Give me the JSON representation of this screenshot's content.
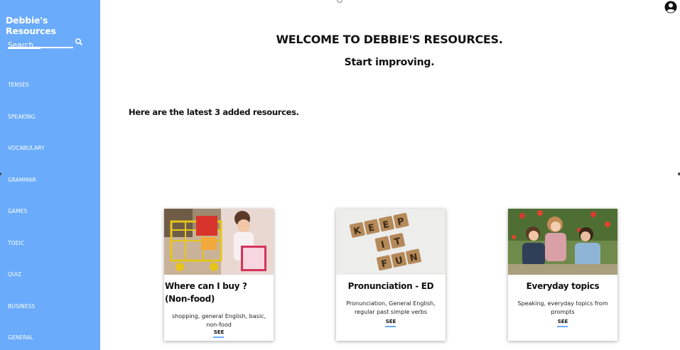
{
  "sidebar": {
    "brand": "Debbie's Resources",
    "search_label": "Search...",
    "items": [
      {
        "label": "TENSES"
      },
      {
        "label": "SPEAKING"
      },
      {
        "label": "VOCABULARY"
      },
      {
        "label": "GRAMMAR"
      },
      {
        "label": "GAMES"
      },
      {
        "label": "TOEIC"
      },
      {
        "label": "QUIZ"
      },
      {
        "label": "BUSINESS"
      },
      {
        "label": "GENERAL"
      }
    ]
  },
  "header": {
    "account_icon": "account-circle-icon"
  },
  "main": {
    "welcome": "WELCOME TO DEBBIE'S RESOURCES.",
    "subtitle": "Start improving.",
    "latest_text": "Here are the latest 3 added resources."
  },
  "cards": [
    {
      "title": "Where can I buy ? (Non-food)",
      "description": "shopping, general English, basic, non-food",
      "see": "SEE"
    },
    {
      "title": "Pronunciation - ED",
      "description": "Pronunciation, General English, regular past simple verbs",
      "see": "SEE"
    },
    {
      "title": "Everyday topics",
      "description": "Speaking, everyday topics from prompts",
      "see": "SEE"
    }
  ],
  "scrabble_tiles": [
    "K",
    "E",
    "E",
    "P",
    "I",
    "T",
    "F",
    "U",
    "N"
  ],
  "colors": {
    "sidebar": "#6aabfb",
    "accent": "#6aabfb"
  }
}
